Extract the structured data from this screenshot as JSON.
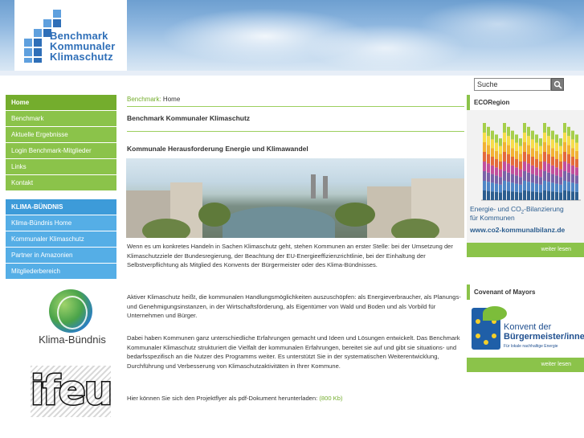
{
  "header": {
    "logo_lines": [
      "Benchmark",
      "Kommunaler",
      "Klimaschutz"
    ]
  },
  "search": {
    "value": "Suche"
  },
  "nav_main": [
    {
      "label": "Home",
      "active": true
    },
    {
      "label": "Benchmark"
    },
    {
      "label": "Aktuelle Ergebnisse"
    },
    {
      "label": "Login Benchmark-Mitglieder"
    },
    {
      "label": "Links"
    },
    {
      "label": "Kontakt"
    }
  ],
  "nav_klima": [
    {
      "label": "KLIMA-BÜNDNIS"
    },
    {
      "label": "Klima-Bündnis Home"
    },
    {
      "label": "Kommunaler Klimaschutz"
    },
    {
      "label": "Partner in Amazonien"
    },
    {
      "label": "Mitgliederbereich"
    }
  ],
  "partner_logos": {
    "klima_buendnis": "Klima-Bündnis",
    "ifeu": "ifeu"
  },
  "breadcrumb": {
    "link": "Benchmark:",
    "current": "Home"
  },
  "main": {
    "title": "Benchmark Kommunaler Klimaschutz",
    "subtitle": "Kommunale Herausforderung Energie und Klimawandel",
    "p1": "Wenn es um konkretes Handeln in Sachen Klimaschutz geht, stehen Kommunen an erster Stelle: bei der Umsetzung der Klimaschutzziele der Bundesregierung, der Beachtung der EU-Energieeffizienzrichtlinie, bei der Einhaltung der Selbstverpflichtung als Mitglied des Konvents der Bürgermeister oder des Klima-Bündnisses.",
    "p2": "Aktiver Klimaschutz heißt, die kommunalen Handlungsmöglichkeiten auszuschöpfen: als Energieverbraucher, als Planungs- und Genehmigungsinstanzen, in der Wirtschaftsförderung, als Eigentümer von Wald und Boden und als Vorbild für Unternehmen und Bürger.",
    "p3": "Dabei haben Kommunen ganz unterschiedliche Erfahrungen gemacht und Ideen und Lösungen entwickelt. Das Benchmark Kommunaler Klimaschutz strukturiert die Vielfalt der kommunalen Erfahrungen, bereitet sie auf und gibt sie situations- und bedarfsspezifisch an die Nutzer des Programms weiter. Es unterstützt Sie in der systematischen Weiterentwicklung, Durchführung und Verbesserung von Klimaschutzaktivitäten in Ihrer Kommune.",
    "p4_prefix": "Hier können Sie sich den Projektflyer als pdf-Dokument herunterladen:",
    "p4_link": "(800 Kb)"
  },
  "ecoregion": {
    "title": "ECORegion",
    "caption_1": "Energie- und CO",
    "caption_sub": "2",
    "caption_1b": "-Bilanzierung",
    "caption_2": "für Kommunen",
    "url": "www.co2-kommunalbilanz.de",
    "more": "weiter lesen",
    "bar_colors": [
      "#2b5d8f",
      "#4f86c6",
      "#7a62a8",
      "#c24f9c",
      "#e46a3a",
      "#f2b233",
      "#f7dd4a",
      "#a6cf4a"
    ]
  },
  "covenant": {
    "title": "Covenant of Mayors",
    "logo_line1": "Konvent der",
    "logo_line2": "Bürgermeister/innen",
    "logo_line3": "Für lokale nachhaltige Energie",
    "more": "weiter lesen"
  }
}
